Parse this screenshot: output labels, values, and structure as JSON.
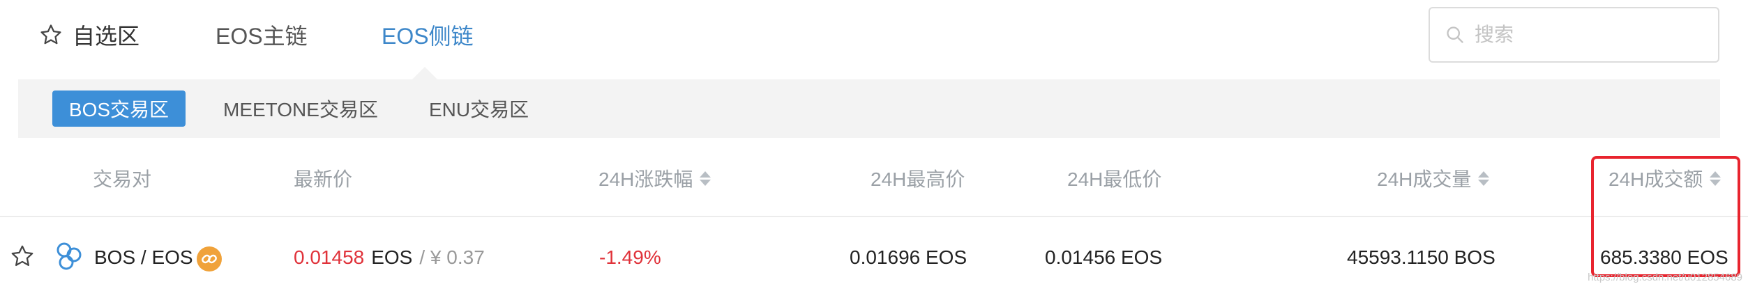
{
  "tabs": [
    {
      "label": "自选区",
      "icon": "star-outline-icon"
    },
    {
      "label": "EOS主链"
    },
    {
      "label": "EOS侧链",
      "active": true
    }
  ],
  "search": {
    "placeholder": "搜索",
    "value": ""
  },
  "subtabs": [
    {
      "label": "BOS交易区",
      "active": true
    },
    {
      "label": "MEETONE交易区"
    },
    {
      "label": "ENU交易区"
    }
  ],
  "columns": [
    {
      "label": "交易对"
    },
    {
      "label": "最新价"
    },
    {
      "label": "24H涨跌幅",
      "sortable": true
    },
    {
      "label": "24H最高价"
    },
    {
      "label": "24H最低价"
    },
    {
      "label": "24H成交量",
      "sortable": true
    },
    {
      "label": "24H成交额",
      "sortable": true,
      "highlighted": true
    }
  ],
  "rows": [
    {
      "pair": "BOS / EOS",
      "price": "0.01458",
      "price_unit": "EOS",
      "price_fiat": "/ ¥ 0.37",
      "change": "-1.49%",
      "high": "0.01696 EOS",
      "low": "0.01456 EOS",
      "volume": "45593.1150 BOS",
      "turnover": "685.3380 EOS"
    }
  ],
  "watermark": "https://blog.csdn.net/u012854689",
  "colors": {
    "accent": "#3d87c9",
    "active_subtab_bg": "#3d8fd8",
    "negative": "#e0323a",
    "highlight_border": "#e8242e",
    "link_badge": "#f0a23a"
  }
}
